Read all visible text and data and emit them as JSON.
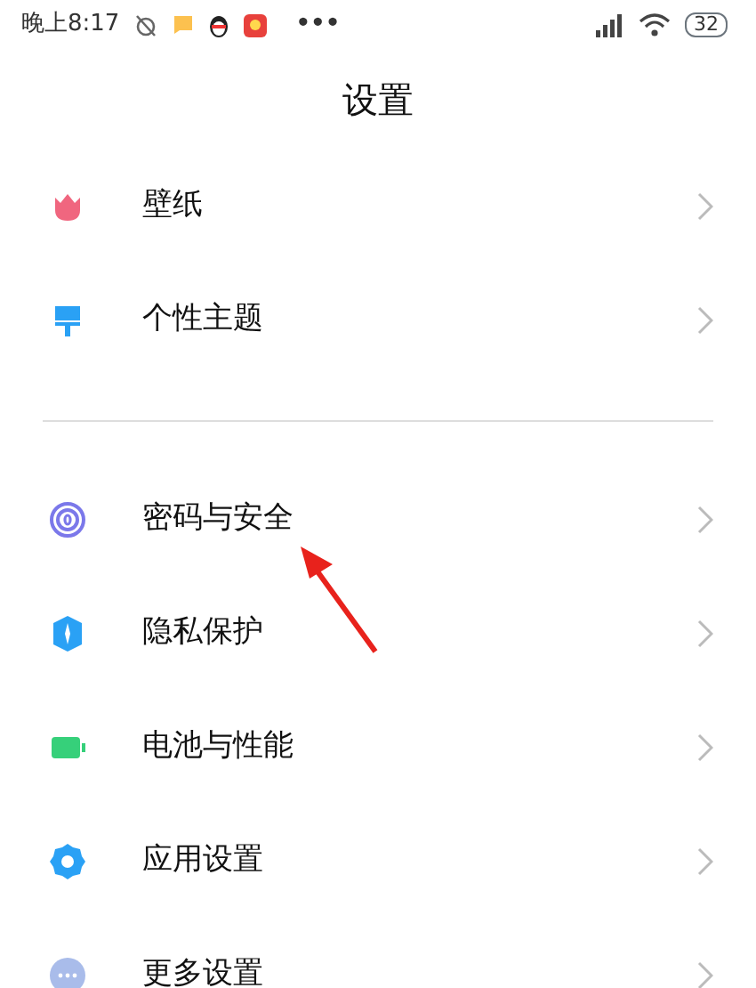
{
  "status_bar": {
    "time": "晚上8:17",
    "more": "•••",
    "battery": "32"
  },
  "title": "设置",
  "groups": [
    [
      {
        "label": "壁纸",
        "kind": "tulip"
      },
      {
        "label": "个性主题",
        "kind": "brush"
      }
    ],
    [
      {
        "label": "密码与安全",
        "kind": "fingerprint"
      },
      {
        "label": "隐私保护",
        "kind": "shield"
      },
      {
        "label": "电池与性能",
        "kind": "battery"
      },
      {
        "label": "应用设置",
        "kind": "gear"
      },
      {
        "label": "更多设置",
        "kind": "dots"
      }
    ]
  ]
}
